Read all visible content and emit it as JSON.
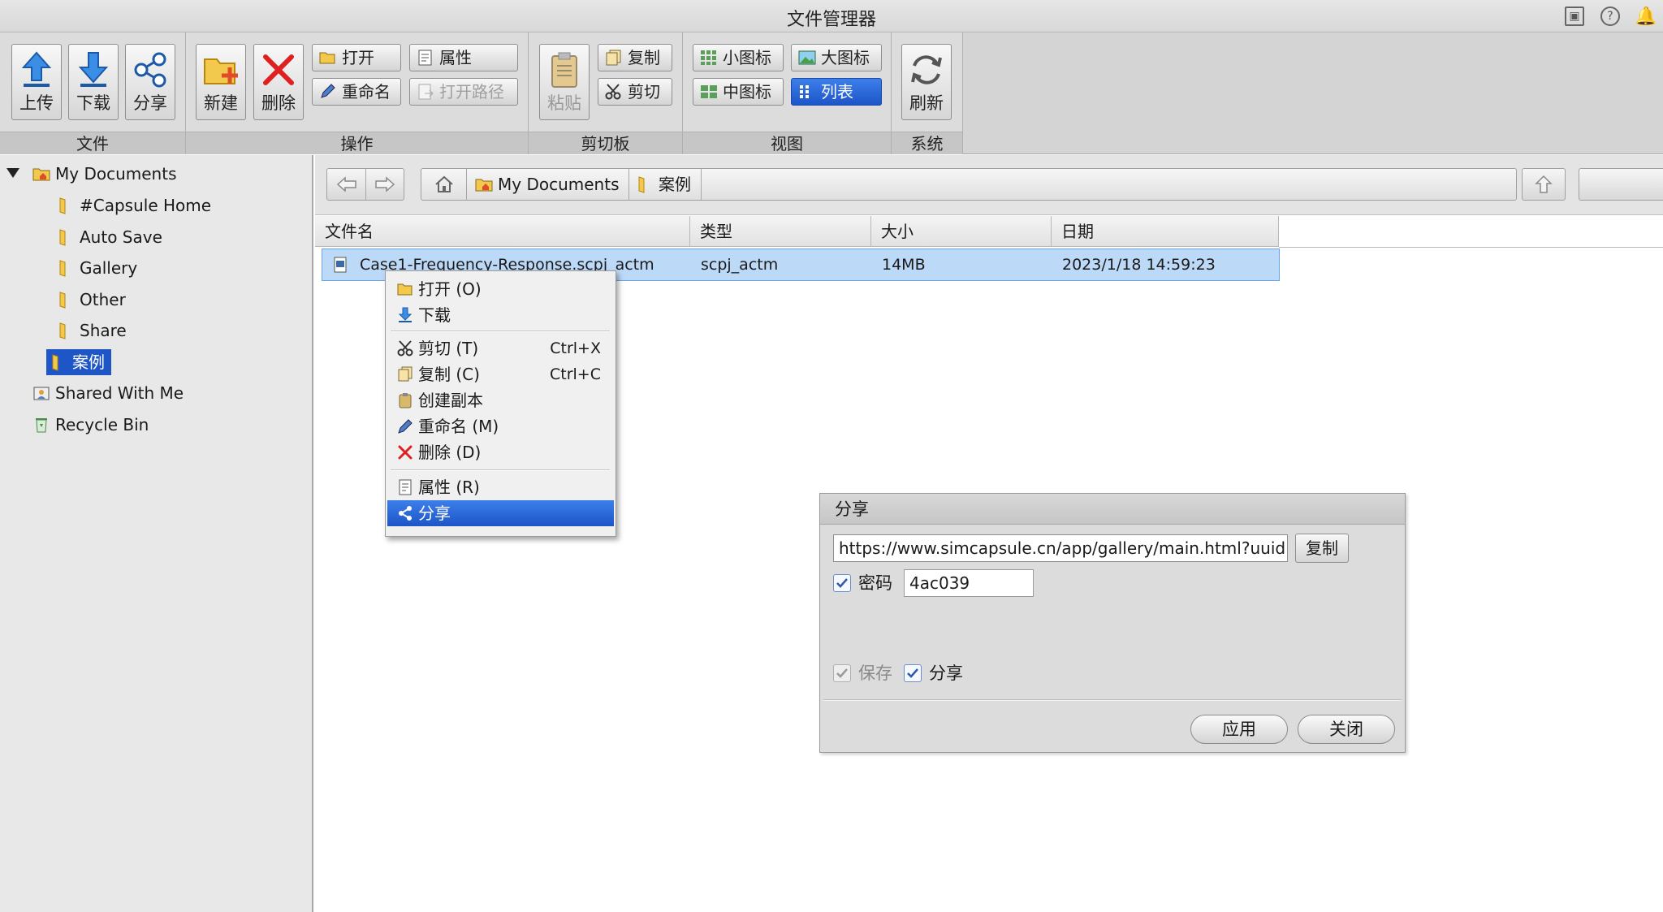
{
  "window": {
    "title": "文件管理器"
  },
  "ribbon": {
    "groups": {
      "file": "文件",
      "ops": "操作",
      "clipboard": "剪切板",
      "view": "视图",
      "system": "系统"
    },
    "buttons": {
      "upload": "上传",
      "download": "下载",
      "share": "分享",
      "new": "新建",
      "delete": "删除",
      "open": "打开",
      "properties": "属性",
      "rename": "重命名",
      "open_path": "打开路径",
      "paste": "粘贴",
      "copy": "复制",
      "cut": "剪切",
      "small_icons": "小图标",
      "large_icons": "大图标",
      "medium_icons": "中图标",
      "list": "列表",
      "refresh": "刷新"
    }
  },
  "tree": {
    "root": "My Documents",
    "children": [
      "#Capsule Home",
      "Auto Save",
      "Gallery",
      "Other",
      "Share",
      "案例"
    ],
    "shared": "Shared With Me",
    "recycle": "Recycle Bin"
  },
  "path": {
    "crumbs": [
      "My Documents",
      "案例"
    ]
  },
  "filelist": {
    "columns": [
      "文件名",
      "类型",
      "大小",
      "日期"
    ],
    "rows": [
      {
        "name": "Case1-Frequency-Response.scpj_actm",
        "type": "scpj_actm",
        "size": "14MB",
        "date": "2023/1/18 14:59:23"
      }
    ]
  },
  "context_menu": {
    "items": [
      {
        "label": "打开 (O)",
        "shortcut": ""
      },
      {
        "label": "下载",
        "shortcut": ""
      },
      {
        "label": "剪切 (T)",
        "shortcut": "Ctrl+X"
      },
      {
        "label": "复制 (C)",
        "shortcut": "Ctrl+C"
      },
      {
        "label": "创建副本",
        "shortcut": ""
      },
      {
        "label": "重命名 (M)",
        "shortcut": ""
      },
      {
        "label": "删除 (D)",
        "shortcut": ""
      },
      {
        "label": "属性 (R)",
        "shortcut": ""
      },
      {
        "label": "分享",
        "shortcut": ""
      }
    ]
  },
  "share_dialog": {
    "title": "分享",
    "url": "https://www.simcapsule.cn/app/gallery/main.html?uuid",
    "copy_label": "复制",
    "password_label": "密码",
    "password_value": "4ac039",
    "save_label": "保存",
    "share_label": "分享",
    "apply_label": "应用",
    "close_label": "关闭"
  },
  "colors": {
    "selection": "#1e56c8",
    "row_highlight": "#bcd9f7"
  },
  "icons": [
    "upload-icon",
    "download-icon",
    "share-icon",
    "new-folder-icon",
    "delete-icon",
    "paste-icon",
    "refresh-icon",
    "folder-icon",
    "back-icon",
    "forward-icon",
    "home-icon",
    "up-icon"
  ]
}
